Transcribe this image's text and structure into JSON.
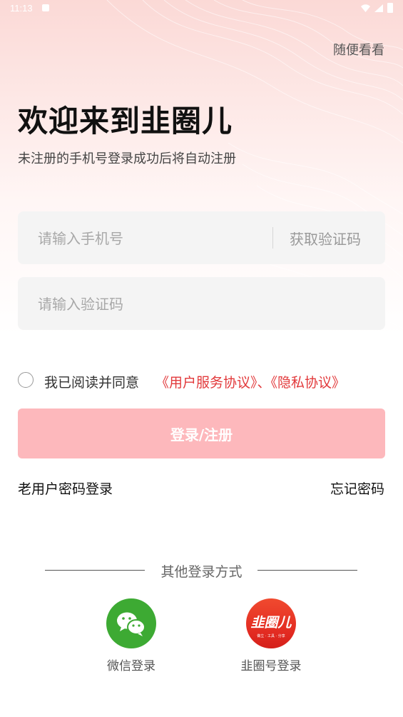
{
  "status_bar": {
    "time": "11:13"
  },
  "header": {
    "skip_label": "随便看看"
  },
  "welcome": {
    "title": "欢迎来到韭圈儿",
    "subtitle": "未注册的手机号登录成功后将自动注册"
  },
  "form": {
    "phone_placeholder": "请输入手机号",
    "get_code_label": "获取验证码",
    "code_placeholder": "请输入验证码"
  },
  "agreement": {
    "checked": false,
    "prefix": "我已阅读并同意",
    "links_text": "《用户服务协议》、《隐私协议》"
  },
  "login_button_label": "登录/注册",
  "links": {
    "password_login": "老用户密码登录",
    "forgot_password": "忘记密码"
  },
  "other_login": {
    "title": "其他登录方式",
    "options": [
      {
        "label": "微信登录",
        "icon": "wechat-icon"
      },
      {
        "label": "韭圈号登录",
        "icon": "jiuquan-logo-icon",
        "logo_text": "韭圈儿",
        "logo_tagline": "做立 · 工具 · 分享"
      }
    ]
  },
  "colors": {
    "accent_red": "#e2393b",
    "login_button": "#fdb8bc",
    "wechat_green": "#3daa33",
    "input_bg": "#f4f4f4"
  }
}
